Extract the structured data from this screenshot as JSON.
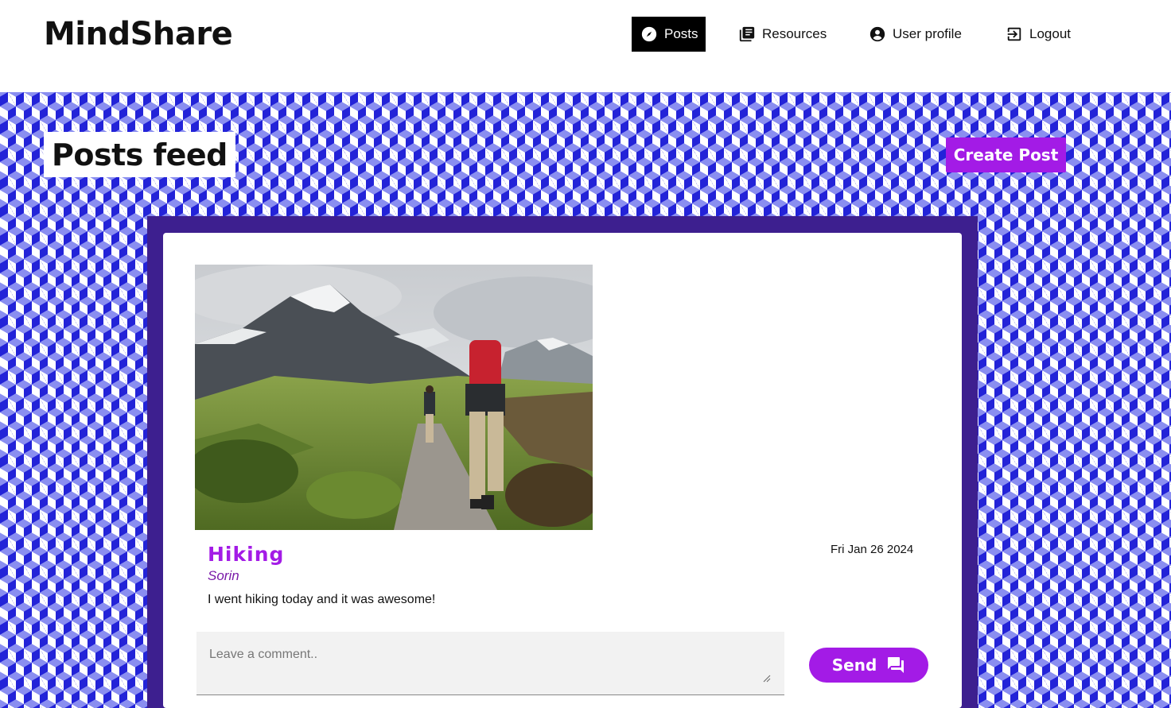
{
  "app": {
    "name": "MindShare"
  },
  "nav": {
    "items": [
      {
        "label": "Posts",
        "icon": "compass-icon",
        "active": true
      },
      {
        "label": "Resources",
        "icon": "library-books-icon",
        "active": false
      },
      {
        "label": "User profile",
        "icon": "account-circle-icon",
        "active": false
      },
      {
        "label": "Logout",
        "icon": "logout-icon",
        "active": false
      }
    ]
  },
  "page": {
    "title": "Posts feed",
    "create_button": "Create Post"
  },
  "post": {
    "title": "Hiking",
    "author": "Sorin",
    "date": "Fri Jan 26 2024",
    "body": "I went hiking today and it was awesome!",
    "image_icon": "hiking-photo"
  },
  "comment": {
    "placeholder": "Leave a comment..",
    "value": "",
    "send_label": "Send",
    "send_icon": "forum-icon"
  },
  "colors": {
    "accent": "#a31be6",
    "nav_active_bg": "#000000",
    "frame": "#3d1f8f",
    "pattern_dark": "#2323d8",
    "pattern_mid": "#8a8ef0"
  }
}
